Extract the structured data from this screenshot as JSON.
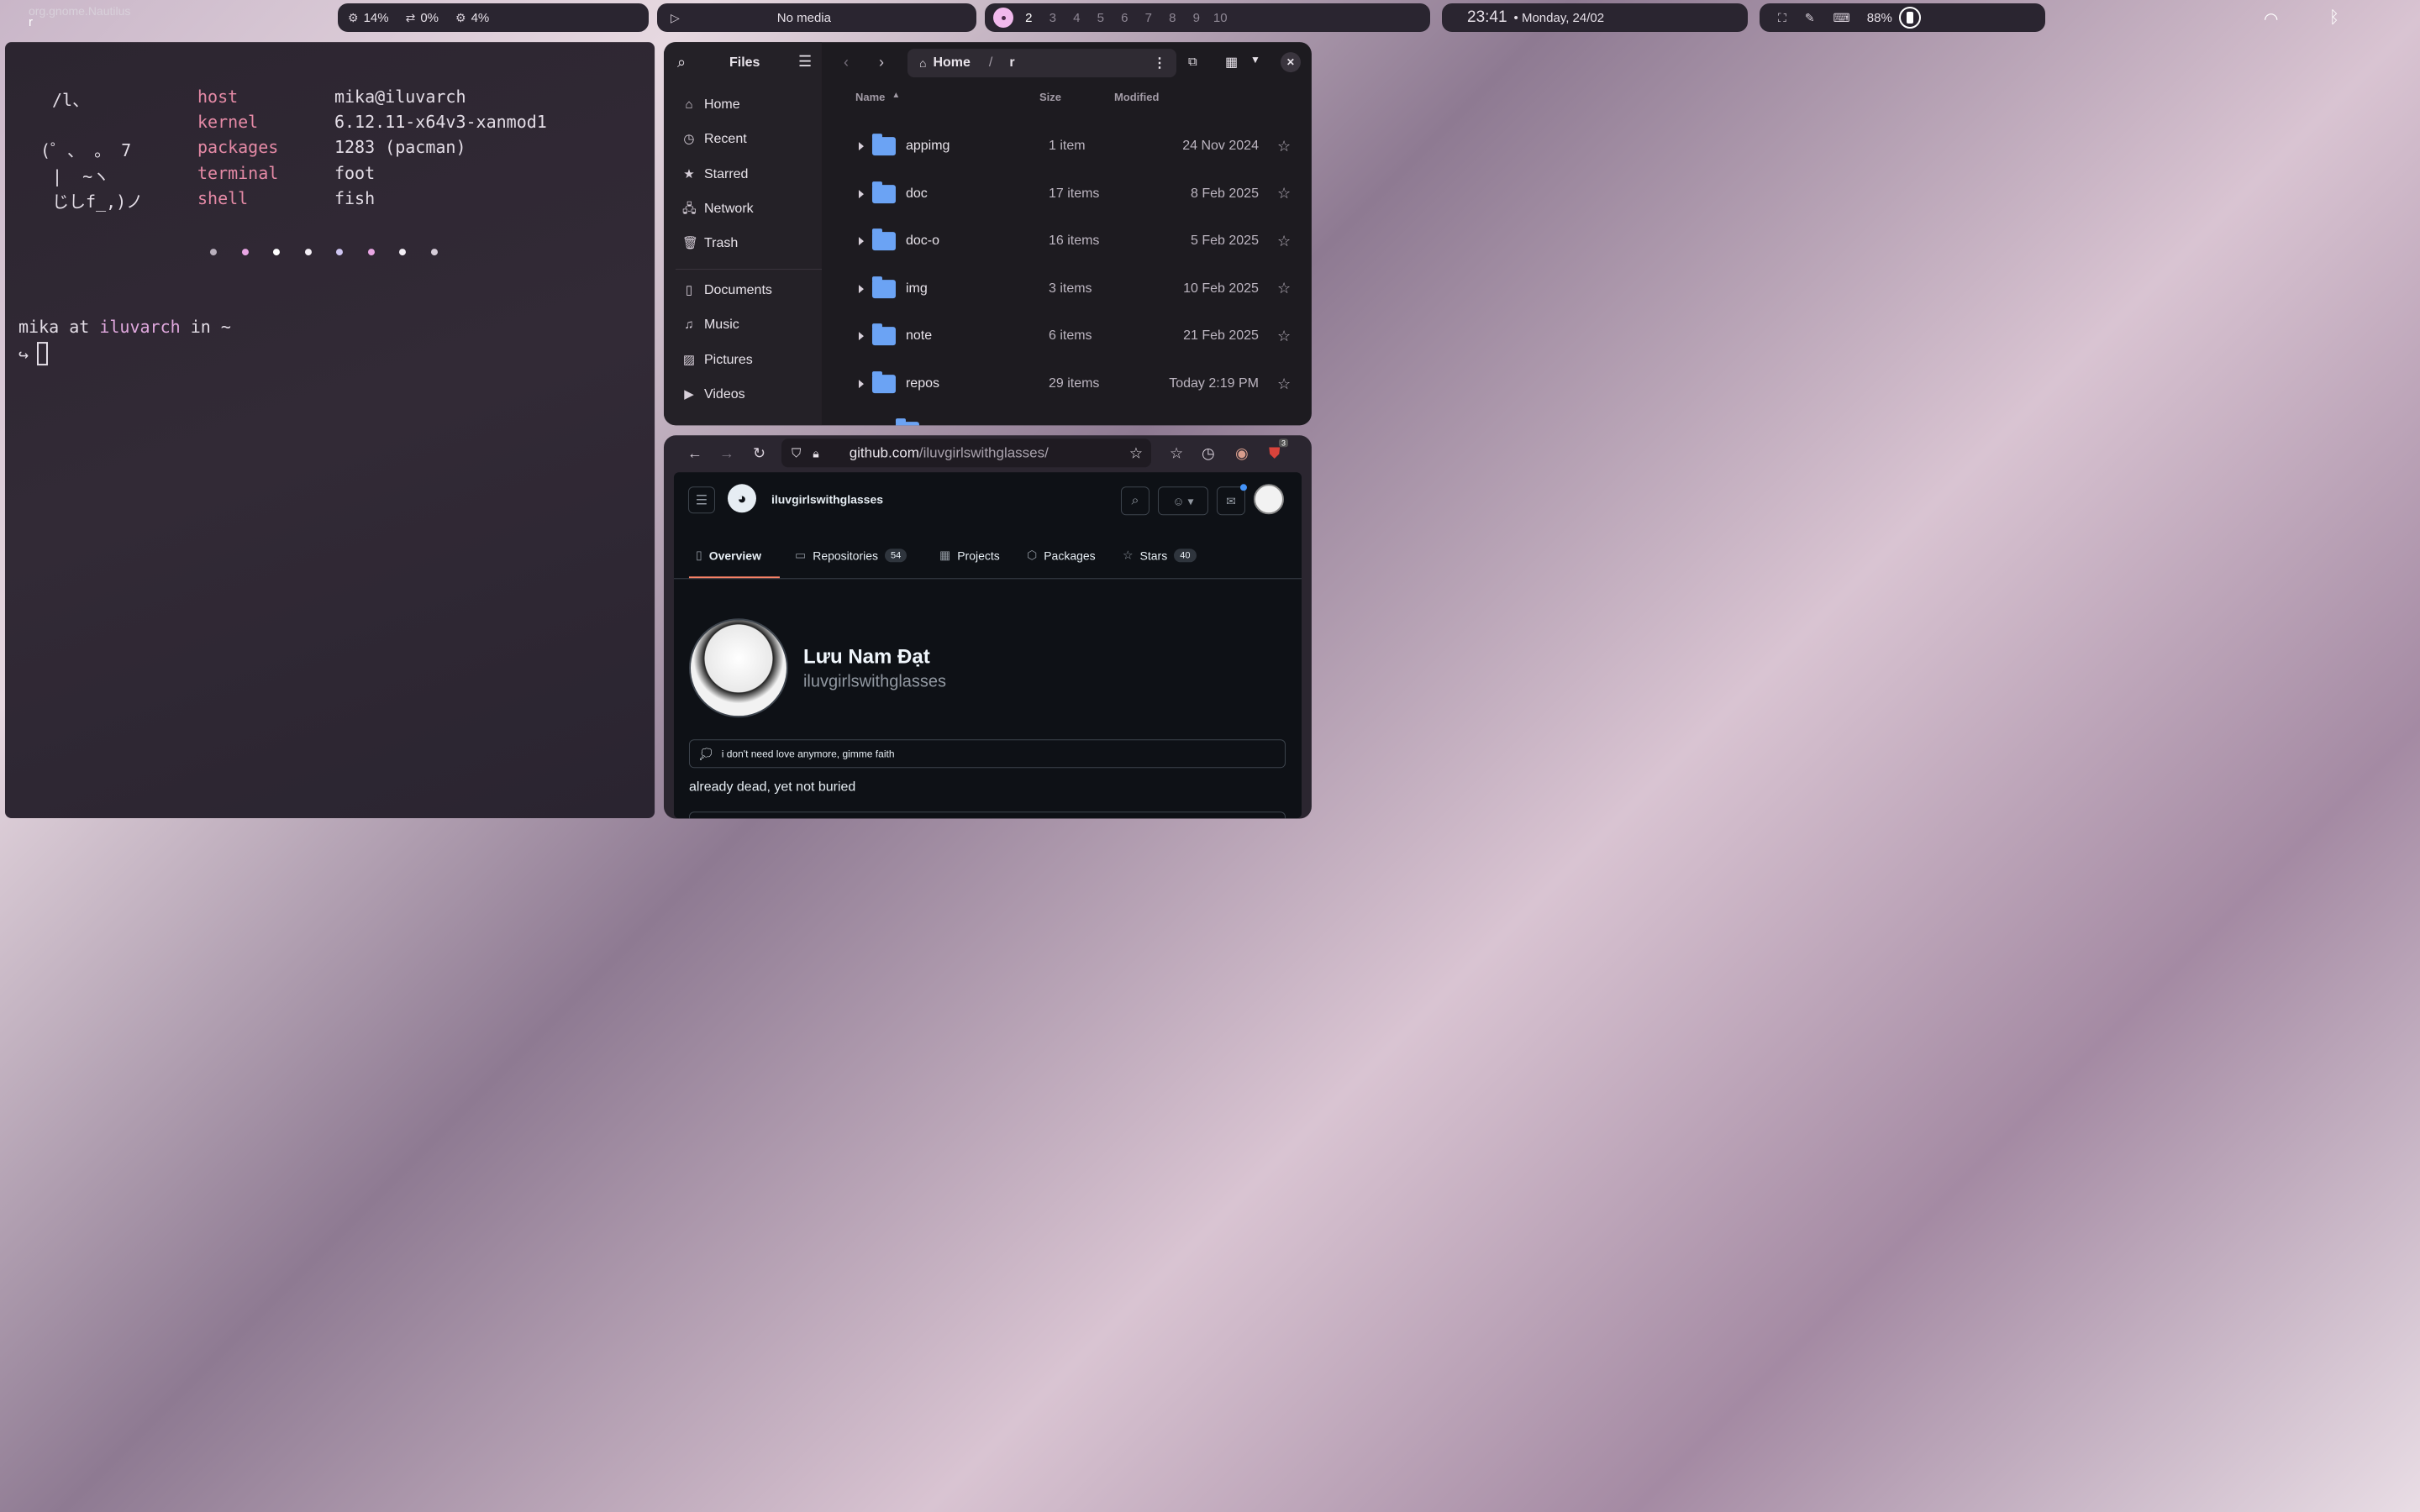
{
  "topbar": {
    "app_id": "org.gnome.Nautilus",
    "window_title": "r",
    "cpu": "14%",
    "swap": "0%",
    "mem": "4%",
    "media": "No media",
    "workspaces": [
      "2",
      "3",
      "4",
      "5",
      "6",
      "7",
      "8",
      "9",
      "10"
    ],
    "time": "23:41",
    "date": "• Monday, 24/02",
    "battery": "88%"
  },
  "terminal": {
    "ascii": [
      "/l、",
      "(゜、 。 7",
      "|  ~ヽ",
      "じしf_,)ノ"
    ],
    "labels": [
      "host",
      "kernel",
      "packages",
      "terminal",
      "shell"
    ],
    "values": [
      "mika@iluvarch",
      "6.12.11-x64v3-xanmod1",
      "1283 (pacman)",
      "foot",
      "fish"
    ],
    "dot_colors": [
      "#b9b0bd",
      "#e9a6e4",
      "#ffffff",
      "#f3eef5",
      "#cfc6f2",
      "#e9a6e4",
      "#f3eef5",
      "#d6cdd9"
    ],
    "prompt_user": "mika",
    "prompt_at": "at",
    "prompt_host": "iluvarch",
    "prompt_in": "in ~",
    "prompt_arrow": "↪"
  },
  "files": {
    "title": "Files",
    "crumb_home": "Home",
    "crumb_sep": "/",
    "crumb_cur": "r",
    "sidebar": [
      {
        "label": "Home",
        "icon": "home-icon"
      },
      {
        "label": "Recent",
        "icon": "clock-icon"
      },
      {
        "label": "Starred",
        "icon": "star-icon"
      },
      {
        "label": "Network",
        "icon": "network-icon"
      },
      {
        "label": "Trash",
        "icon": "trash-icon"
      }
    ],
    "places": [
      {
        "label": "Documents",
        "icon": "document-icon"
      },
      {
        "label": "Music",
        "icon": "music-icon"
      },
      {
        "label": "Pictures",
        "icon": "picture-icon"
      },
      {
        "label": "Videos",
        "icon": "video-icon"
      }
    ],
    "columns": {
      "name": "Name",
      "size": "Size",
      "modified": "Modified"
    },
    "rows": [
      {
        "name": "appimg",
        "size": "1 item",
        "modified": "24 Nov 2024"
      },
      {
        "name": "doc",
        "size": "17 items",
        "modified": "8 Feb 2025"
      },
      {
        "name": "doc-o",
        "size": "16 items",
        "modified": "5 Feb 2025"
      },
      {
        "name": "img",
        "size": "3 items",
        "modified": "10 Feb 2025"
      },
      {
        "name": "note",
        "size": "6 items",
        "modified": "21 Feb 2025"
      },
      {
        "name": "repos",
        "size": "29 items",
        "modified": "Today 2:19 PM"
      }
    ]
  },
  "browser": {
    "url_host": "github.com",
    "url_path": "/iluvgirlswithglasses/",
    "ext_badge": "3",
    "gh": {
      "username": "iluvgirlswithglasses",
      "tabs": [
        {
          "label": "Overview"
        },
        {
          "label": "Repositories",
          "count": "54"
        },
        {
          "label": "Projects"
        },
        {
          "label": "Packages"
        },
        {
          "label": "Stars",
          "count": "40"
        }
      ],
      "fullname": "Lưu Nam Đạt",
      "handle": "iluvgirlswithglasses",
      "status": "i don't need love anymore, gimme faith",
      "bio": "already dead, yet not buried"
    }
  }
}
